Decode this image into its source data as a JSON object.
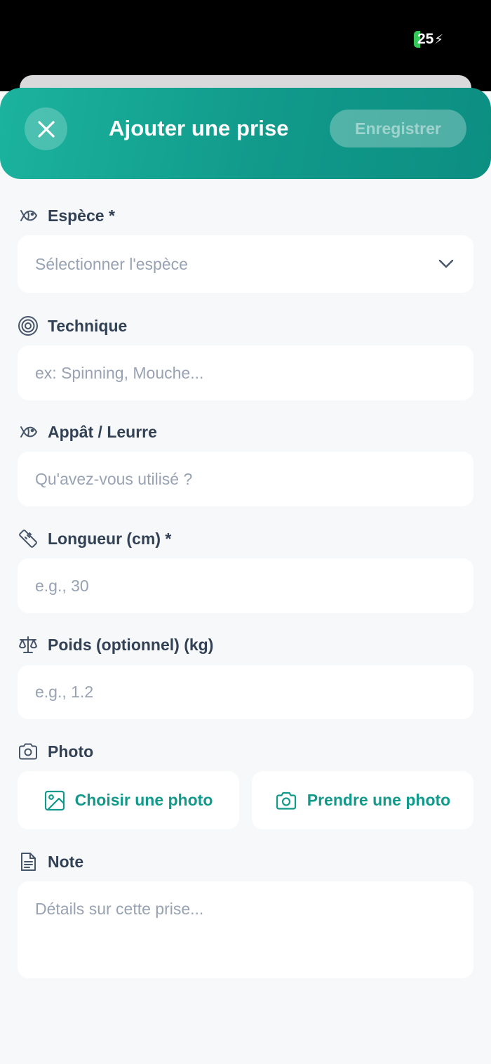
{
  "status_bar": {
    "battery": "25"
  },
  "header": {
    "title": "Ajouter une prise",
    "save_label": "Enregistrer",
    "close_icon": "close-icon"
  },
  "form": {
    "species": {
      "label": "Espèce *",
      "placeholder": "Sélectionner l'espèce",
      "icon": "fish-icon"
    },
    "technique": {
      "label": "Technique",
      "placeholder": "ex: Spinning, Mouche...",
      "icon": "target-icon"
    },
    "bait": {
      "label": "Appât / Leurre",
      "placeholder": "Qu'avez-vous utilisé ?",
      "icon": "fish-icon"
    },
    "length": {
      "label": "Longueur (cm) *",
      "placeholder": "e.g., 30",
      "icon": "ruler-icon"
    },
    "weight": {
      "label": "Poids (optionnel) (kg)",
      "placeholder": "e.g., 1.2",
      "icon": "scale-icon"
    },
    "photo": {
      "label": "Photo",
      "icon": "camera-icon",
      "choose_label": "Choisir une photo",
      "take_label": "Prendre une photo"
    },
    "note": {
      "label": "Note",
      "placeholder": "Détails sur cette prise...",
      "icon": "document-icon"
    }
  },
  "colors": {
    "accent": "#11998a",
    "accent_light": "#1bb39e",
    "background": "#f6f8fa",
    "label": "#334155",
    "placeholder": "#98a2b3"
  }
}
